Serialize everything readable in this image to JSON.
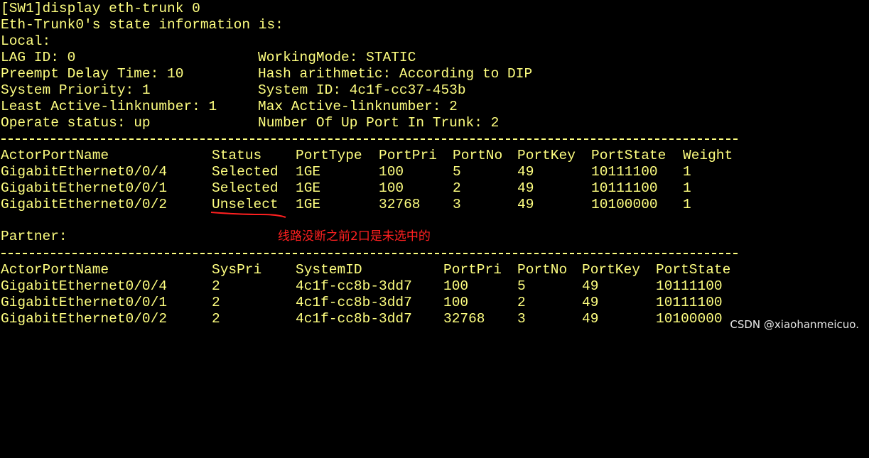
{
  "terminal": {
    "command": "[SW1]display eth-trunk 0",
    "state_header": "Eth-Trunk0's state information is:",
    "local_label": "Local:",
    "info_rows": [
      {
        "left": "LAG ID: 0",
        "right": "WorkingMode: STATIC"
      },
      {
        "left": "Preempt Delay Time: 10",
        "right": "Hash arithmetic: According to DIP"
      },
      {
        "left": "System Priority: 1",
        "right": "System ID: 4c1f-cc37-453b"
      },
      {
        "left": "Least Active-linknumber: 1",
        "right": "Max Active-linknumber: 2"
      },
      {
        "left": "Operate status: up",
        "right": "Number Of Up Port In Trunk: 2"
      }
    ],
    "local_table": {
      "headers": [
        "ActorPortName",
        "Status",
        "PortType",
        "PortPri",
        "PortNo",
        "PortKey",
        "PortState",
        "Weight"
      ],
      "rows": [
        [
          "GigabitEthernet0/0/4",
          "Selected",
          "1GE",
          "100",
          "5",
          "49",
          "10111100",
          "1"
        ],
        [
          "GigabitEthernet0/0/1",
          "Selected",
          "1GE",
          "100",
          "2",
          "49",
          "10111100",
          "1"
        ],
        [
          "GigabitEthernet0/0/2",
          "Unselect",
          "1GE",
          "32768",
          "3",
          "49",
          "10100000",
          "1"
        ]
      ]
    },
    "partner_label": "Partner:",
    "partner_table": {
      "headers": [
        "ActorPortName",
        "SysPri",
        "SystemID",
        "PortPri",
        "PortNo",
        "PortKey",
        "PortState"
      ],
      "rows": [
        [
          "GigabitEthernet0/0/4",
          "2",
          "4c1f-cc8b-3dd7",
          "100",
          "5",
          "49",
          "10111100"
        ],
        [
          "GigabitEthernet0/0/1",
          "2",
          "4c1f-cc8b-3dd7",
          "100",
          "2",
          "49",
          "10111100"
        ],
        [
          "GigabitEthernet0/0/2",
          "2",
          "4c1f-cc8b-3dd7",
          "32768",
          "3",
          "49",
          "10100000"
        ]
      ]
    }
  },
  "annotation": {
    "text": "线路没断之前2口是未选中的",
    "color": "#ff2020"
  },
  "watermark": "CSDN @xiaohanmeicuo.",
  "colors": {
    "background": "#000000",
    "text": "#ffff80",
    "annotation": "#ff2020"
  }
}
